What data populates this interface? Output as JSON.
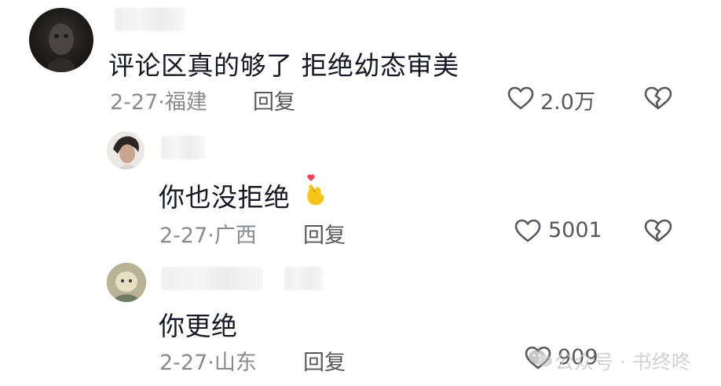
{
  "comments": [
    {
      "text": "评论区真的够了 拒绝幼态审美",
      "date": "2-27",
      "location": "福建",
      "reply_label": "回复",
      "likes": "2.0万"
    },
    {
      "text": "你也没拒绝",
      "date": "2-27",
      "location": "广西",
      "reply_label": "回复",
      "likes": "5001",
      "emoji": "finger-heart-emoji"
    },
    {
      "text": "你更绝",
      "date": "2-27",
      "location": "山东",
      "reply_label": "回复",
      "likes": "909"
    }
  ],
  "watermark": {
    "text": "公众号 · 书终咚"
  },
  "icons": {
    "like": "heart-outline-icon",
    "dislike": "broken-heart-icon"
  },
  "colors": {
    "text": "#161823",
    "meta": "#8a8b91",
    "action": "#57585e"
  }
}
